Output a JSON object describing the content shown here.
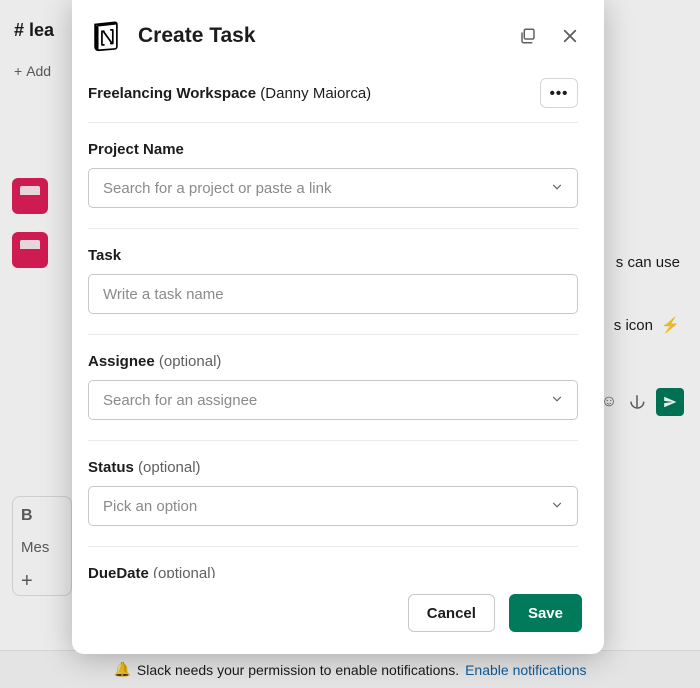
{
  "background": {
    "channel_name": "# lea",
    "add_bookmark": "Add ",
    "right_text_1": "s can use",
    "right_text_2": "s icon",
    "lightning": "⚡",
    "bold_b": "B",
    "mes": "Mes",
    "plus": "+",
    "notification_bell": "🔔",
    "notification_text": "Slack needs your permission to enable notifications.",
    "notification_link": "Enable notifications"
  },
  "modal": {
    "title": "Create Task",
    "workspace_name": "Freelancing Workspace",
    "workspace_user": "(Danny Maiorca)",
    "more_dots": "•••",
    "footer": {
      "cancel": "Cancel",
      "save": "Save"
    },
    "fields": {
      "project": {
        "label": "Project Name",
        "placeholder": "Search for a project or paste a link"
      },
      "task": {
        "label": "Task",
        "placeholder": "Write a task name"
      },
      "assignee": {
        "label": "Assignee",
        "optional": "(optional)",
        "placeholder": "Search for an assignee"
      },
      "status": {
        "label": "Status",
        "optional": "(optional)",
        "placeholder": "Pick an option"
      },
      "duedate": {
        "label": "DueDate",
        "optional": "(optional)"
      }
    }
  }
}
